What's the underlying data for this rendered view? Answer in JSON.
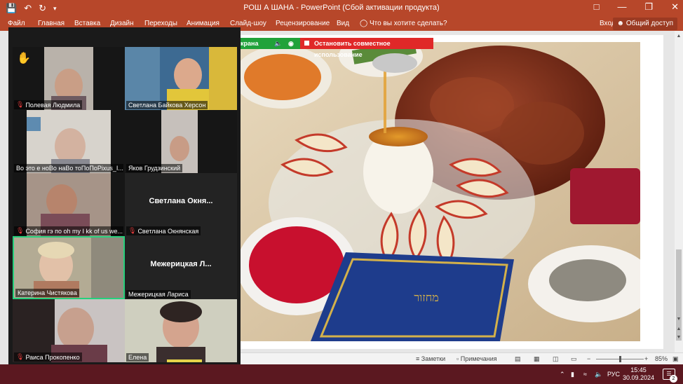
{
  "window": {
    "title": "РОШ А ШАНА - PowerPoint (Сбой активации продукта)"
  },
  "ribbon": {
    "tabs": [
      "Файл",
      "Главная",
      "Вставка",
      "Дизайн",
      "Переходы",
      "Анимация",
      "Слайд-шоу",
      "Рецензирование",
      "Вид"
    ],
    "tell_me": "Что вы хотите сделать?",
    "sign_in": "Вход",
    "share": "Общий доступ"
  },
  "share_bar": {
    "screen_label": "крана",
    "stop_label": "Остановить совместное использование"
  },
  "participants": [
    {
      "name": "Полевая Людмила",
      "muted": true,
      "hand_raised": true,
      "video": true
    },
    {
      "name": "Светлана Байкова Херсон",
      "muted": false,
      "video": true
    },
    {
      "name": "Во это е ноВо наВо тоПоПоPixus_I...",
      "muted": false,
      "video": true
    },
    {
      "name": "Яков Грудзинский",
      "muted": false,
      "video": true
    },
    {
      "name": "София гэ по oh my I kk of us we...",
      "muted": true,
      "video": true
    },
    {
      "name": "Светлана Окнянская",
      "display_name": "Светлана Окня...",
      "muted": true,
      "video": false
    },
    {
      "name": "Катерина Чистякова",
      "muted": false,
      "video": true,
      "active_speaker": true
    },
    {
      "name": "Межерицкая Лариса",
      "display_name": "Межерицкая Л...",
      "muted": false,
      "video": false
    },
    {
      "name": "Раиса Прокопенко",
      "muted": true,
      "video": true
    },
    {
      "name": "Елена",
      "muted": false,
      "video": true
    }
  ],
  "statusbar": {
    "notes": "Заметки",
    "comments": "Примечания",
    "zoom": "85%"
  },
  "taskbar": {
    "lang": "РУС",
    "time": "15:45",
    "date": "30.09.2024",
    "notifications": "2"
  },
  "colors": {
    "ppt_accent": "#b7472a",
    "share_green": "#20a23a",
    "stop_red": "#e02828",
    "active_speaker": "#26d07c"
  }
}
